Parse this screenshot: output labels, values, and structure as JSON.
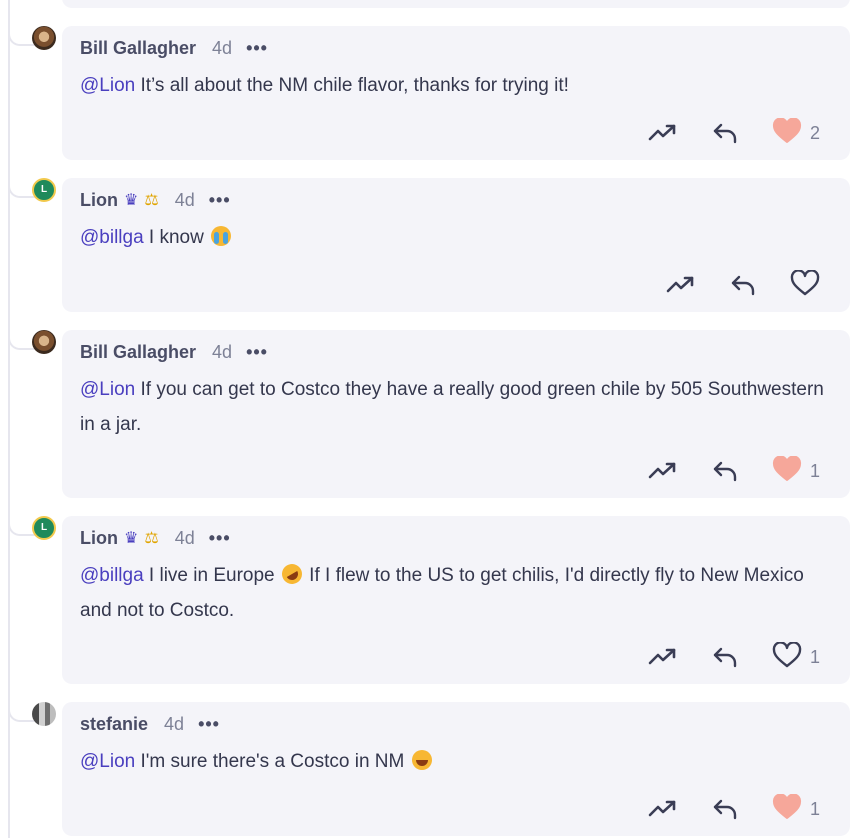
{
  "colors": {
    "card_background": "#f4f4f9",
    "mention": "#4a3fbf",
    "text": "#34374d",
    "author": "#4a4d66",
    "muted": "#7d8196",
    "liked_heart": "#f6a79a",
    "avatar_lion": "#1f8a5b",
    "avatar_lion_ring": "#f2c94c"
  },
  "comments": [
    {
      "author": "Bill Gallagher",
      "avatar": "bill-photo",
      "badges": [],
      "time": "4d",
      "more": "•••",
      "mention": "@Lion",
      "text": " It’s all about the NM chile flavor, thanks for trying it!",
      "liked": true,
      "likes": "2"
    },
    {
      "author": "Lion",
      "avatar_letter": "L",
      "badges": [
        "crown-icon",
        "scales-icon"
      ],
      "crown_glyph": "♛",
      "scales_glyph": "⚖",
      "time": "4d",
      "more": "•••",
      "mention": "@billga",
      "text": " I know ",
      "emoji": "loudly-crying-face-emoji",
      "liked": false,
      "likes": ""
    },
    {
      "author": "Bill Gallagher",
      "avatar": "bill-photo",
      "badges": [],
      "time": "4d",
      "more": "•••",
      "mention": "@Lion",
      "text": " If you can get to Costco they have a really good green chile by 505 Southwestern in a jar.",
      "liked": true,
      "likes": "1"
    },
    {
      "author": "Lion",
      "avatar_letter": "L",
      "badges": [
        "crown-icon",
        "scales-icon"
      ],
      "crown_glyph": "♛",
      "scales_glyph": "⚖",
      "time": "4d",
      "more": "•••",
      "mention": "@billga",
      "text_before_emoji": " I live in Europe ",
      "emoji": "rolling-on-floor-laughing-emoji",
      "text": " If I flew to the US to get chilis, I'd directly fly to New Mexico and not to Costco.",
      "liked": false,
      "likes": "1"
    },
    {
      "author": "stefanie",
      "avatar": "stefanie-photo",
      "badges": [],
      "time": "4d",
      "more": "•••",
      "mention": "@Lion",
      "text": " I'm sure there's a Costco in NM ",
      "emoji": "face-with-tears-of-joy-emoji",
      "liked": true,
      "likes": "1"
    }
  ]
}
